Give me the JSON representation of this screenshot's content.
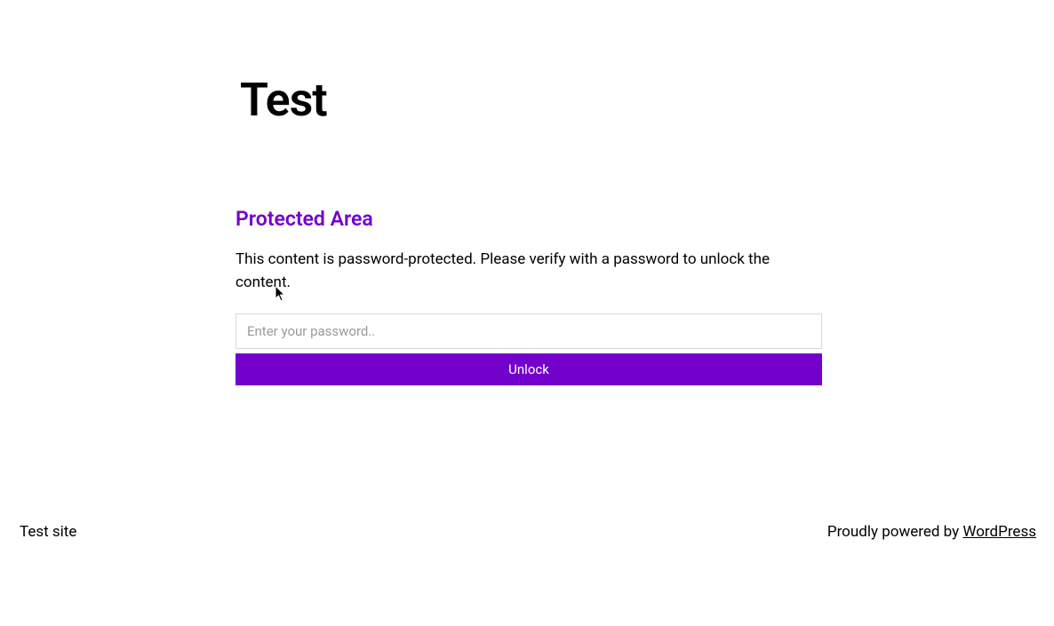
{
  "header": {
    "site_title": "Test"
  },
  "main": {
    "heading": "Protected Area",
    "description": "This content is password-protected. Please verify with a password to unlock the content.",
    "password_placeholder": "Enter your password..",
    "unlock_label": "Unlock"
  },
  "footer": {
    "site_name": "Test site",
    "powered_by_text": "Proudly powered by ",
    "powered_by_link": "WordPress"
  },
  "colors": {
    "accent": "#7400cc"
  }
}
